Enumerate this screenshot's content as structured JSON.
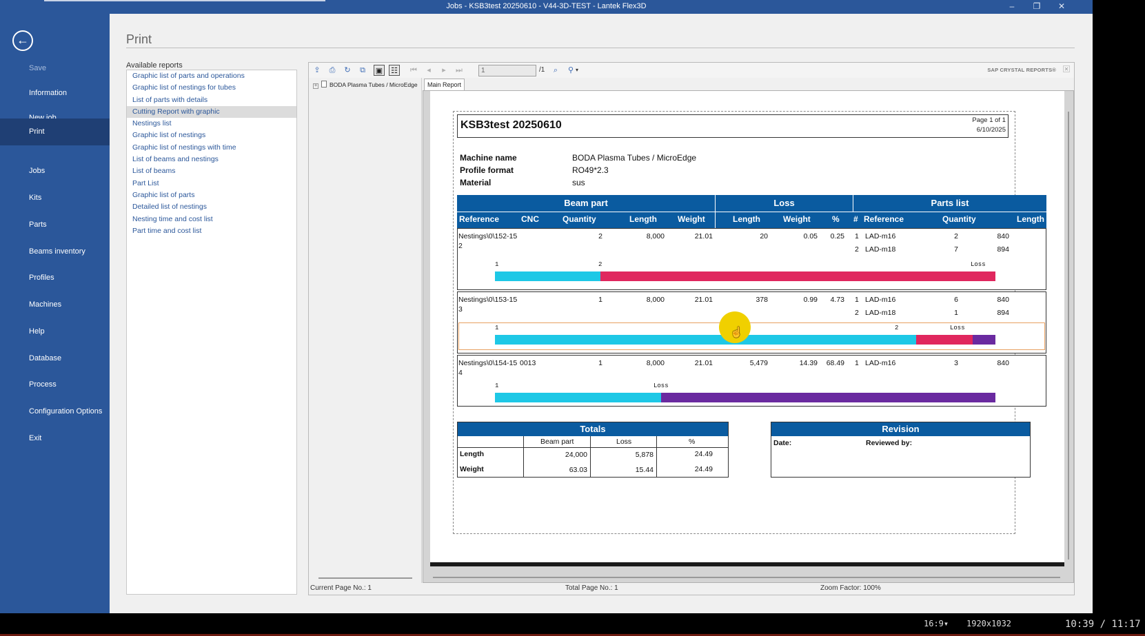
{
  "window": {
    "title": "Jobs - KSB3test 20250610 - V44-3D-TEST - Lantek Flex3D",
    "minimize": "–",
    "restore": "❐",
    "close": "✕"
  },
  "sidebar": {
    "back_icon": "←",
    "items": [
      {
        "label": "Save"
      },
      {
        "label": "Information"
      },
      {
        "label": "New job"
      },
      {
        "label": "Print"
      },
      {
        "label": "Jobs"
      },
      {
        "label": "Kits"
      },
      {
        "label": "Parts"
      },
      {
        "label": "Beams inventory"
      },
      {
        "label": "Profiles"
      },
      {
        "label": "Machines"
      },
      {
        "label": "Help"
      },
      {
        "label": "Database"
      },
      {
        "label": "Process"
      },
      {
        "label": "Configuration Options"
      },
      {
        "label": "Exit"
      }
    ]
  },
  "main": {
    "title": "Print",
    "available_label": "Available reports",
    "reports": [
      "Graphic list of parts and operations",
      "Graphic list of nestings for tubes",
      "List of parts with details",
      "Cutting Report with graphic",
      "Nestings list",
      "Graphic list of nestings",
      "Graphic list of nestings with time",
      "List of beams and nestings",
      "List of beams",
      "Part List",
      "Graphic list of parts",
      "Detailed list of nestings",
      "Nesting time and cost list",
      "Part time and cost list"
    ]
  },
  "viewer": {
    "page_input": "1",
    "page_total": "/1",
    "brand": "SAP CRYSTAL REPORTS®",
    "tree_node": "BODA Plasma Tubes / MicroEdge",
    "tab": "Main Report",
    "status": {
      "current": "Current Page No.: 1",
      "total": "Total Page No.: 1",
      "zoom": "Zoom Factor: 100%"
    }
  },
  "report": {
    "title": "KSB3test 20250610",
    "page": "Page 1 of 1",
    "date": "6/10/2025",
    "machine_label": "Machine name",
    "machine_value": "BODA Plasma Tubes / MicroEdge",
    "profile_label": "Profile format",
    "profile_value": "RO49*2.3",
    "material_label": "Material",
    "material_value": "sus",
    "groups": {
      "beam": "Beam part",
      "loss": "Loss",
      "parts": "Parts list"
    },
    "columns": {
      "reference": "Reference",
      "cnc": "CNC",
      "quantity": "Quantity",
      "length": "Length",
      "weight": "Weight",
      "loss_length": "Length",
      "loss_weight": "Weight",
      "loss_pct": "%",
      "num": "#",
      "p_reference": "Reference",
      "p_quantity": "Quantity",
      "p_length": "Length"
    },
    "rows": [
      {
        "ref1": "Nestings\\0\\152-15",
        "ref2": "2",
        "cnc": "",
        "quantity": "2",
        "length": "8,000",
        "weight": "21.01",
        "loss_length": "20",
        "loss_weight": "0.05",
        "loss_pct": "0.25",
        "parts": [
          {
            "num": "1",
            "ref": "LAD-m16",
            "qty": "2",
            "len": "840"
          },
          {
            "num": "2",
            "ref": "LAD-m18",
            "qty": "7",
            "len": "894"
          }
        ],
        "bar_labels": {
          "a": "1",
          "b": "2",
          "loss": "Loss"
        }
      },
      {
        "ref1": "Nestings\\0\\153-15",
        "ref2": "3",
        "cnc": "",
        "quantity": "1",
        "length": "8,000",
        "weight": "21.01",
        "loss_length": "378",
        "loss_weight": "0.99",
        "loss_pct": "4.73",
        "parts": [
          {
            "num": "1",
            "ref": "LAD-m16",
            "qty": "6",
            "len": "840"
          },
          {
            "num": "2",
            "ref": "LAD-m18",
            "qty": "1",
            "len": "894"
          }
        ],
        "bar_labels": {
          "a": "1",
          "b": "2",
          "loss": "Loss"
        }
      },
      {
        "ref1": "Nestings\\0\\154-15",
        "ref2": "4",
        "cnc": "0013",
        "quantity": "1",
        "length": "8,000",
        "weight": "21.01",
        "loss_length": "5,479",
        "loss_weight": "14.39",
        "loss_pct": "68.49",
        "parts": [
          {
            "num": "1",
            "ref": "LAD-m16",
            "qty": "3",
            "len": "840"
          }
        ],
        "bar_labels": {
          "a": "1",
          "loss": "Loss"
        }
      }
    ],
    "totals": {
      "title": "Totals",
      "h_beam": "Beam part",
      "h_loss": "Loss",
      "h_pct": "%",
      "length_label": "Length",
      "length_beam": "24,000",
      "length_loss": "5,878",
      "length_pct": "24.49",
      "weight_label": "Weight",
      "weight_beam": "63.03",
      "weight_loss": "15.44",
      "weight_pct": "24.49"
    },
    "revision": {
      "title": "Revision",
      "date_label": "Date:",
      "reviewed_label": "Reviewed by:"
    },
    "colors": {
      "header_blue": "#0a5ba0",
      "part_cyan": "#1ec8e6",
      "part_pink": "#e0275e",
      "loss_purple": "#6a2aa0"
    }
  },
  "taskbar": {
    "ratio": "16:9▾",
    "resolution": "1920x1032",
    "time": "10:39 / 11:17"
  }
}
